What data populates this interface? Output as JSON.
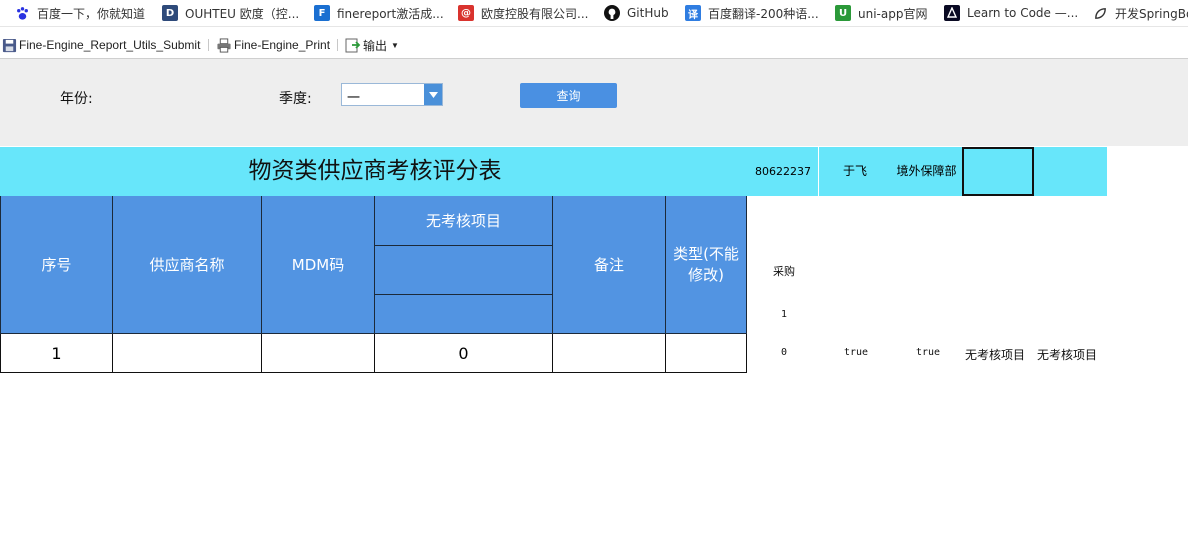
{
  "bookmarks": [
    {
      "label": "百度一下，你就知道",
      "icon": "baidu-paw-icon"
    },
    {
      "label": "OUHTEU 欧度（控...",
      "icon": "ouhteu-logo-icon"
    },
    {
      "label": "finereport激活成...",
      "icon": "finereport-logo-icon"
    },
    {
      "label": "欧度控股有限公司...",
      "icon": "mail-at-icon"
    },
    {
      "label": "GitHub",
      "icon": "github-icon"
    },
    {
      "label": "百度翻译-200种语...",
      "icon": "baidu-translate-icon"
    },
    {
      "label": "uni-app官网",
      "icon": "uniapp-logo-icon"
    },
    {
      "label": "Learn to Code —...",
      "icon": "freecodecamp-icon"
    },
    {
      "label": "开发SpringBo",
      "icon": "spring-leaf-icon"
    }
  ],
  "toolbar": {
    "submit_label": "Fine-Engine_Report_Utils_Submit",
    "print_label": "Fine-Engine_Print",
    "export_label": "输出"
  },
  "params": {
    "year_label": "年份:",
    "quarter_label": "季度:",
    "quarter_value": "一",
    "query_label": "查询"
  },
  "report": {
    "title": "物资类供应商考核评分表",
    "code": "80622237",
    "person": "于飞",
    "department": "境外保障部",
    "headers": {
      "index": "序号",
      "supplier": "供应商名称",
      "mdm": "MDM码",
      "no_assessment": "无考核项目",
      "sub1": "",
      "sub2": "",
      "remark": "备注",
      "type_line1": "类型(不能",
      "type_line2": "修改)"
    },
    "rows": [
      {
        "index": "1",
        "supplier": "",
        "mdm": "",
        "score": "0",
        "remark": "",
        "type": ""
      }
    ],
    "side": {
      "purchase": "采购",
      "one": "1",
      "zero": "0",
      "true1": "true",
      "true2": "true",
      "no_assess1": "无考核项目",
      "no_assess2": "无考核项目"
    }
  },
  "colors": {
    "title_band": "#67e6fa",
    "header_blue": "#5294e2",
    "query_button": "#4a90e2",
    "param_bg": "#eeeeee"
  }
}
